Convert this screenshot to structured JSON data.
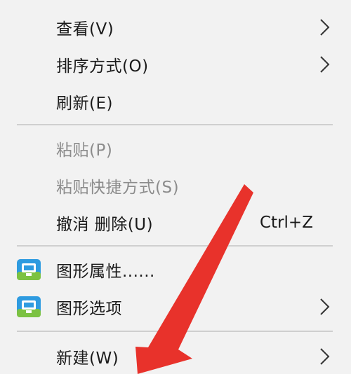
{
  "menu": {
    "view": {
      "label": "查看(V)"
    },
    "sort": {
      "label": "排序方式(O)"
    },
    "refresh": {
      "label": "刷新(E)"
    },
    "paste": {
      "label": "粘贴(P)"
    },
    "paste_shortcut": {
      "label": "粘贴快捷方式(S)"
    },
    "undo": {
      "label": "撤消 删除(U)",
      "shortcut": "Ctrl+Z"
    },
    "graphics_properties": {
      "label": "图形属性......"
    },
    "graphics_options": {
      "label": "图形选项"
    },
    "new": {
      "label": "新建(W)"
    }
  },
  "colors": {
    "background": "#f2f2f2",
    "text": "#1a1a1a",
    "disabled_text": "#8c8c8c",
    "separator": "#cfcfcf",
    "arrow": "#e8322b",
    "icon_blue": "#2e9be0",
    "icon_green": "#7cc242"
  },
  "icons": {
    "submenu": "chevron-right-icon",
    "graphics": "intel-graphics-icon",
    "annotation": "red-arrow"
  }
}
